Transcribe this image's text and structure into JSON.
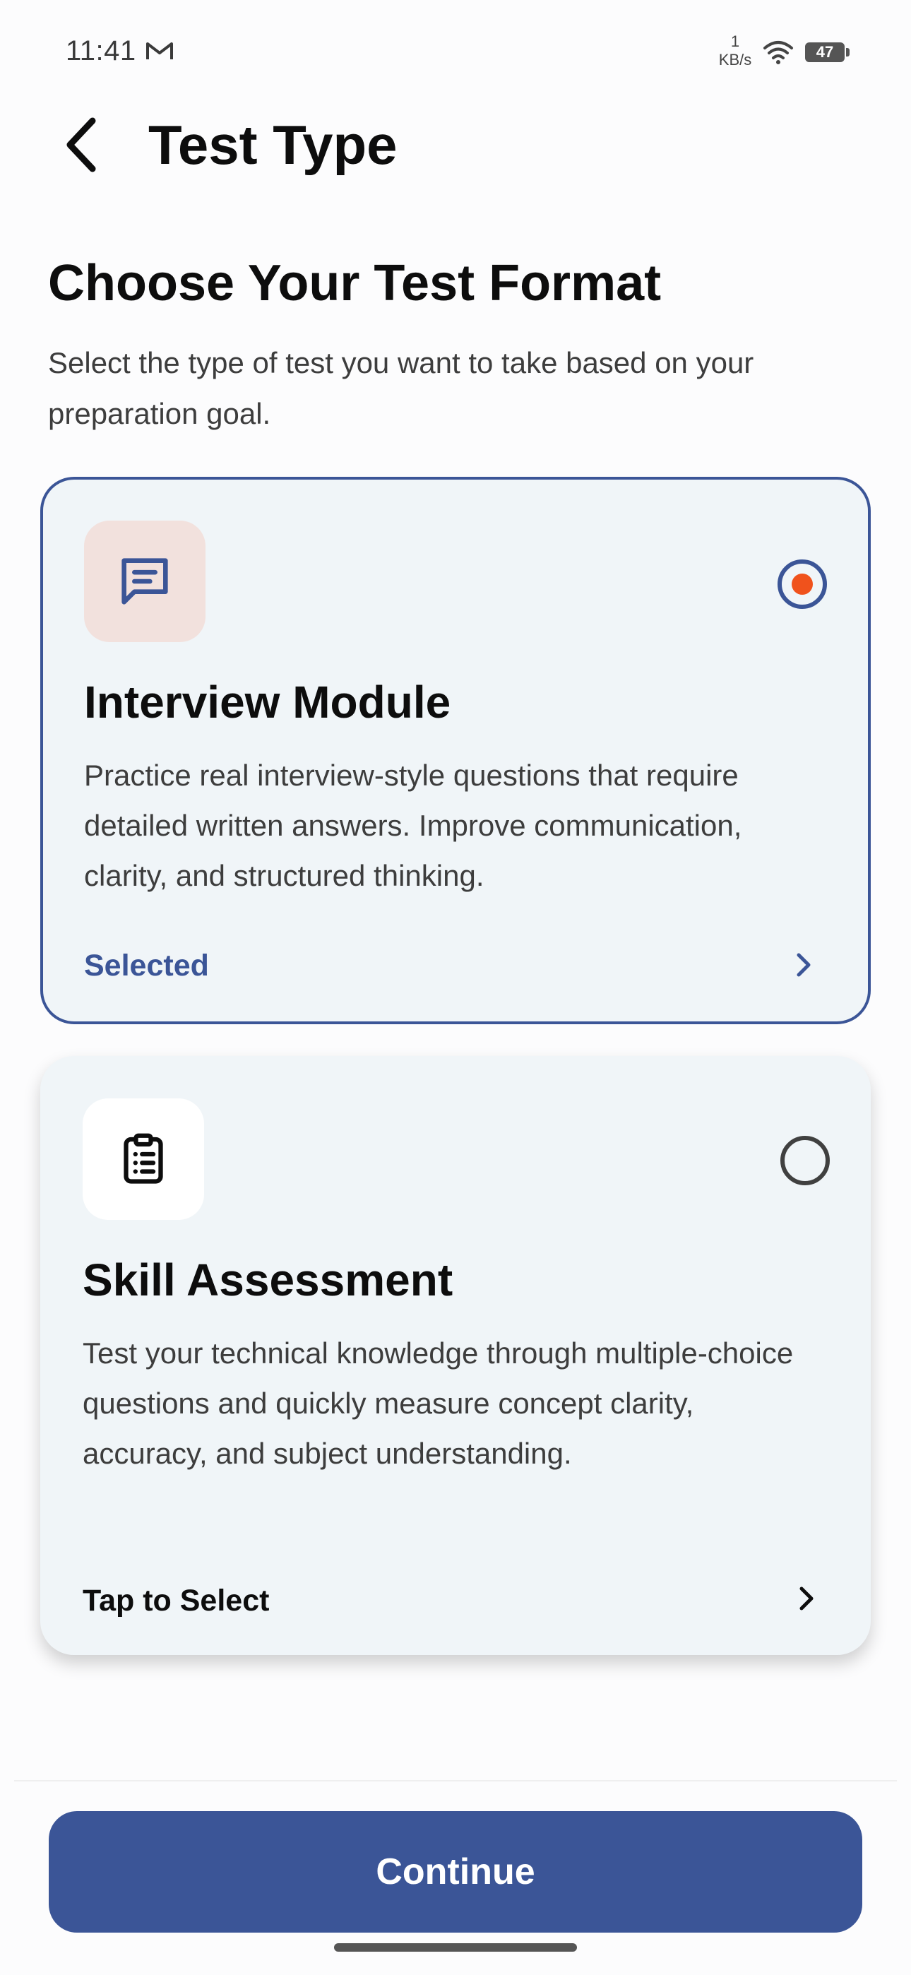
{
  "status_bar": {
    "time": "11:41",
    "net_speed_value": "1",
    "net_speed_unit": "KB/s",
    "battery": "47"
  },
  "header": {
    "title": "Test Type"
  },
  "intro": {
    "title": "Choose Your Test Format",
    "subtitle": "Select the type of test you want to take based on your preparation goal."
  },
  "options": [
    {
      "title": "Interview Module",
      "description": "Practice real interview-style questions that require detailed written answers. Improve communication, clarity, and structured thinking.",
      "status": "Selected",
      "selected": true,
      "icon": "message-square-text-icon"
    },
    {
      "title": "Skill Assessment",
      "description": "Test your technical knowledge through multiple-choice questions and quickly measure concept clarity, accuracy, and subject understanding.",
      "status": "Tap to Select",
      "selected": false,
      "icon": "clipboard-list-icon"
    }
  ],
  "footer": {
    "continue_label": "Continue"
  },
  "colors": {
    "primary": "#3b5597",
    "radio_dot": "#f0521c",
    "card_bg": "#f0f5f8",
    "icon_bg_selected": "#f2e1dd"
  }
}
